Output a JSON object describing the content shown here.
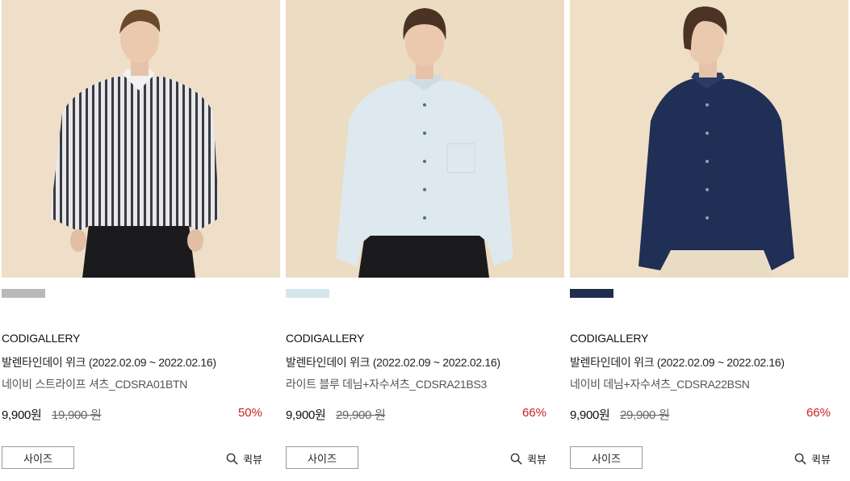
{
  "products": [
    {
      "brand": "CODIGALLERY",
      "event": "발렌타인데이 위크 (2022.02.09 ~ 2022.02.16)",
      "name": "네이비 스트라이프 셔츠_CDSRA01BTN",
      "price": "9,900원",
      "original_price": "19,900 원",
      "discount": "50%",
      "size_button": "사이즈",
      "quick_view": "퀵뷰",
      "swatch_color": "#b9b9bb",
      "image_alt": "model wearing striped shirt"
    },
    {
      "brand": "CODIGALLERY",
      "event": "발렌타인데이 위크 (2022.02.09 ~ 2022.02.16)",
      "name": "라이트 블루 데님+자수셔츠_CDSRA21BS3",
      "price": "9,900원",
      "original_price": "29,900 원",
      "discount": "66%",
      "size_button": "사이즈",
      "quick_view": "퀵뷰",
      "swatch_color": "#d7e6ea",
      "image_alt": "model wearing light blue denim shirt"
    },
    {
      "brand": "CODIGALLERY",
      "event": "발렌타인데이 위크 (2022.02.09 ~ 2022.02.16)",
      "name": "네이비 데님+자수셔츠_CDSRA22BSN",
      "price": "9,900원",
      "original_price": "29,900 원",
      "discount": "66%",
      "size_button": "사이즈",
      "quick_view": "퀵뷰",
      "swatch_color": "#1f2e4d",
      "image_alt": "model wearing navy denim shirt"
    }
  ]
}
